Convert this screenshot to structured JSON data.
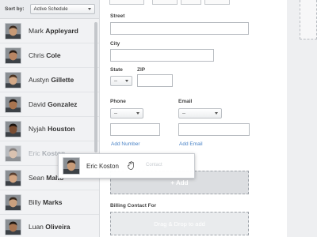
{
  "sidebar": {
    "sort_label": "Sort by:",
    "sort_value": "Active Schedule",
    "people": [
      {
        "first": "Mark",
        "last": "Appleyard",
        "skin": "#c79a76",
        "hair": "#3b2a1f"
      },
      {
        "first": "Chris",
        "last": "Cole",
        "skin": "#b98563",
        "hair": "#2b1d15"
      },
      {
        "first": "Austyn",
        "last": "Gillette",
        "skin": "#d4a987",
        "hair": "#4a3322"
      },
      {
        "first": "David",
        "last": "Gonzalez",
        "skin": "#a9744f",
        "hair": "#1f1611"
      },
      {
        "first": "Nyjah",
        "last": "Houston",
        "skin": "#7a4d32",
        "hair": "#1a120d"
      },
      {
        "first": "Eric",
        "last": "Koston",
        "skin": "#c89c79",
        "hair": "#2e2119"
      },
      {
        "first": "Sean",
        "last": "Malto",
        "skin": "#d2a582",
        "hair": "#5a4030"
      },
      {
        "first": "Billy",
        "last": "Marks",
        "skin": "#caa07e",
        "hair": "#3a2a1e"
      },
      {
        "first": "Luan",
        "last": "Oliveira",
        "skin": "#a87552",
        "hair": "#221812"
      }
    ]
  },
  "form": {
    "street_label": "Street",
    "city_label": "City",
    "state_label": "State",
    "zip_label": "ZIP",
    "state_value": "--",
    "phone_label": "Phone",
    "phone_type_value": "--",
    "email_label": "Email",
    "email_type_value": "--",
    "add_number_link": "Add Number",
    "add_email_link": "Add Email",
    "add_button": "+ Add",
    "billing_label": "Billing Contact For",
    "billing_drop": "Drag & Drop to add"
  },
  "drag": {
    "name": "Eric Koston",
    "under_text": "Contact"
  }
}
